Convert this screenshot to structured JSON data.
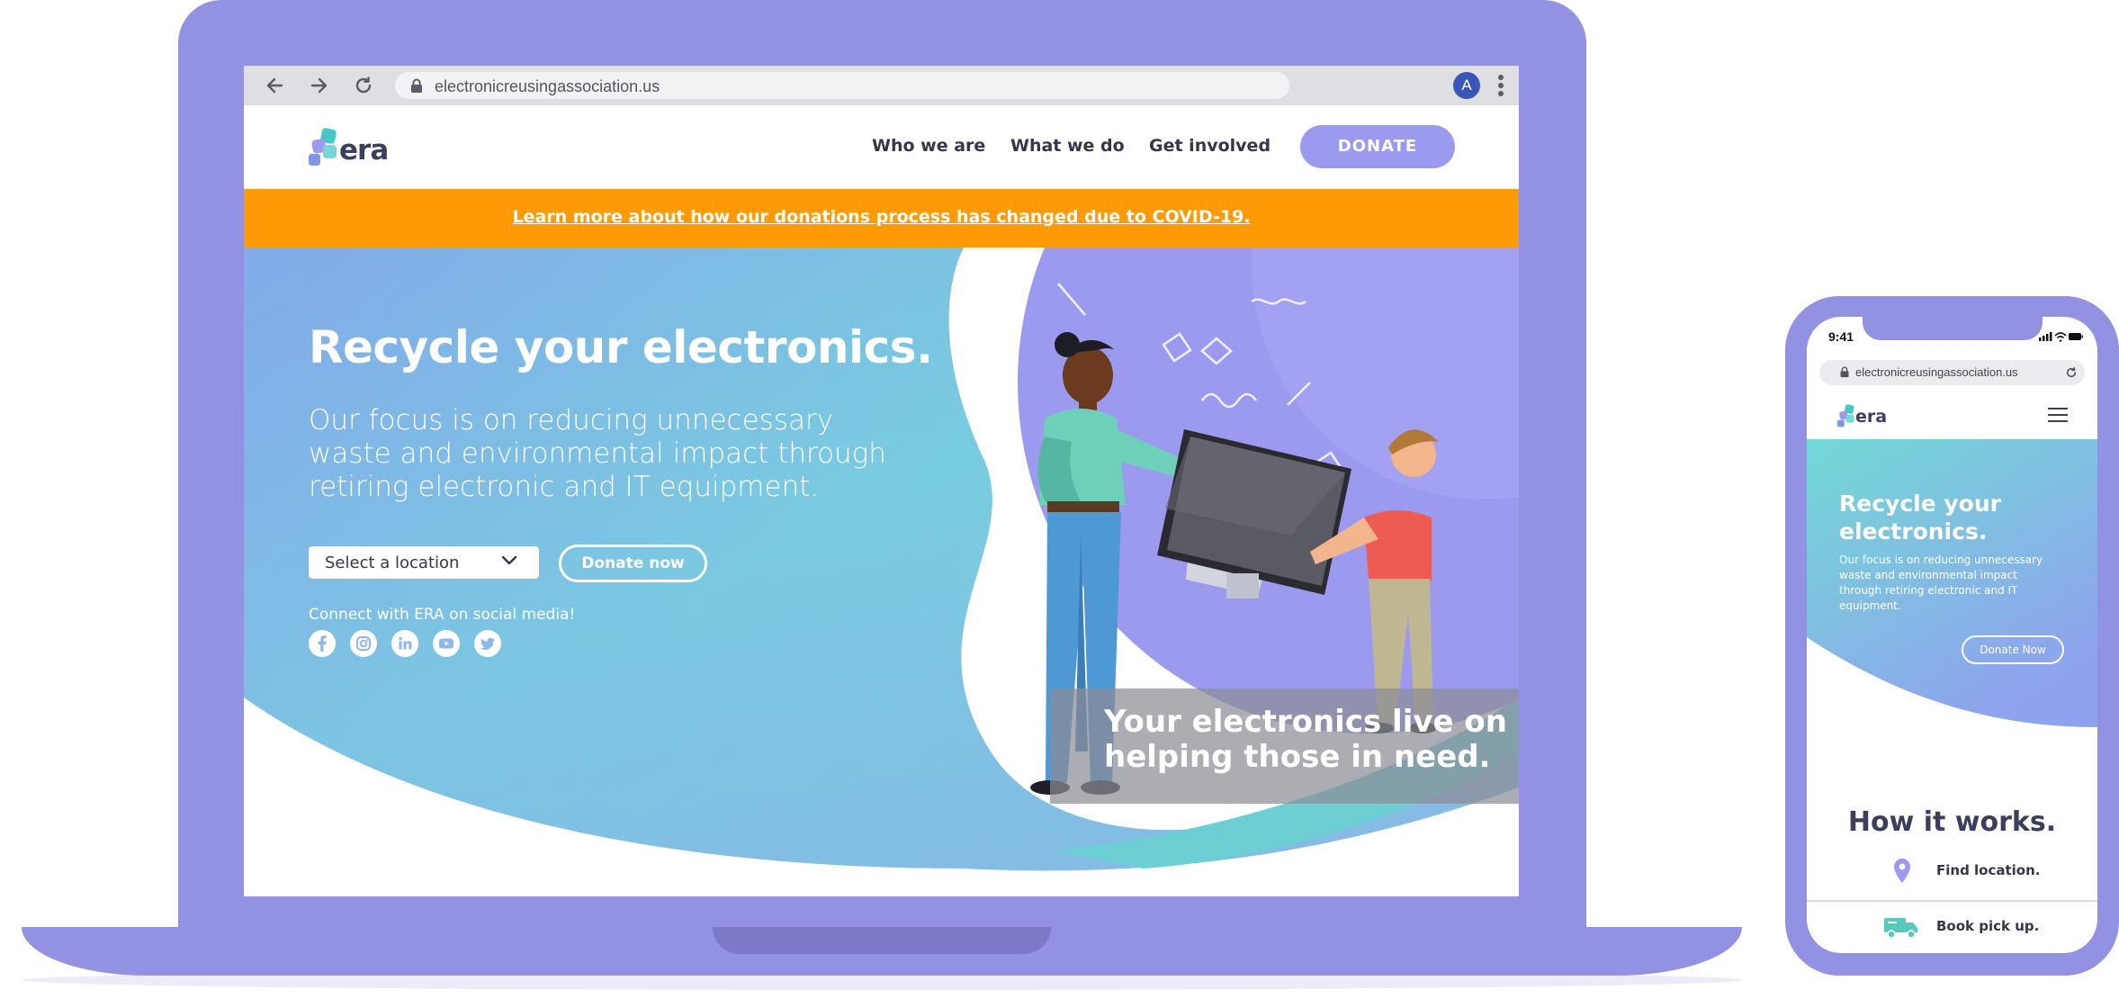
{
  "colors": {
    "device": "#9391e1",
    "accent_purple": "#9c9aef",
    "banner_orange": "#fd9a06",
    "hero_teal": "#72d9d6",
    "hero_blue": "#8fa2ee",
    "text_dark": "#333749"
  },
  "browser": {
    "url": "electronicreusingassociation.us",
    "profile_initial": "A",
    "icons": [
      "back-arrow-icon",
      "forward-arrow-icon",
      "reload-icon",
      "lock-icon",
      "kebab-menu-icon"
    ]
  },
  "site": {
    "logo_text": "era",
    "nav": {
      "who": "Who we are",
      "what": "What we do",
      "involved": "Get involved",
      "donate": "DONATE"
    },
    "banner": "Learn more about how our donations process has changed due to COVID-19.",
    "hero": {
      "title": "Recycle your electronics.",
      "text": "Our focus is on reducing unnecessary waste and environmental impact through retiring electronic and IT equipment.",
      "location_select": "Select a location",
      "donate_button": "Donate now",
      "social_label": "Connect with ERA on social media!",
      "social_icons": [
        "facebook-icon",
        "instagram-icon",
        "linkedin-icon",
        "youtube-icon",
        "twitter-icon"
      ],
      "tagline": "Your electronics live on helping those in need."
    }
  },
  "phone": {
    "time": "9:41",
    "url": "electronicreusingassociation.us",
    "logo_text": "era",
    "hero_title": "Recycle your electronics.",
    "hero_text": "Our focus is on reducing unnecessary waste and environmental impact through retiring electronic and IT equipment.",
    "donate_button": "Donate Now",
    "how_title": "How it works.",
    "steps": [
      {
        "icon": "map-pin-icon",
        "label": "Find location."
      },
      {
        "icon": "truck-icon",
        "label": "Book pick up."
      }
    ]
  }
}
